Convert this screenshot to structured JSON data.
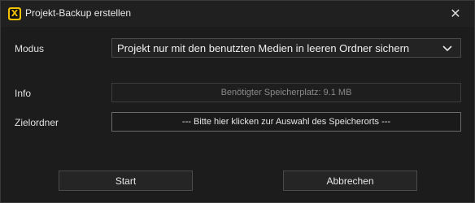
{
  "window": {
    "title": "Projekt-Backup erstellen",
    "app_icon": "app-logo-x-icon",
    "close_icon": "close-icon"
  },
  "form": {
    "mode_label": "Modus",
    "mode_value": "Projekt nur mit den benutzten Medien in leeren Ordner sichern",
    "info_label": "Info",
    "info_value": "Benötigter Speicherplatz: 9.1 MB",
    "target_label": "Zielordner",
    "target_value": "--- Bitte hier klicken zur Auswahl des Speicherorts ---"
  },
  "buttons": {
    "start": "Start",
    "cancel": "Abbrechen"
  },
  "colors": {
    "accent": "#f2c200",
    "background": "#1c1c1c"
  }
}
